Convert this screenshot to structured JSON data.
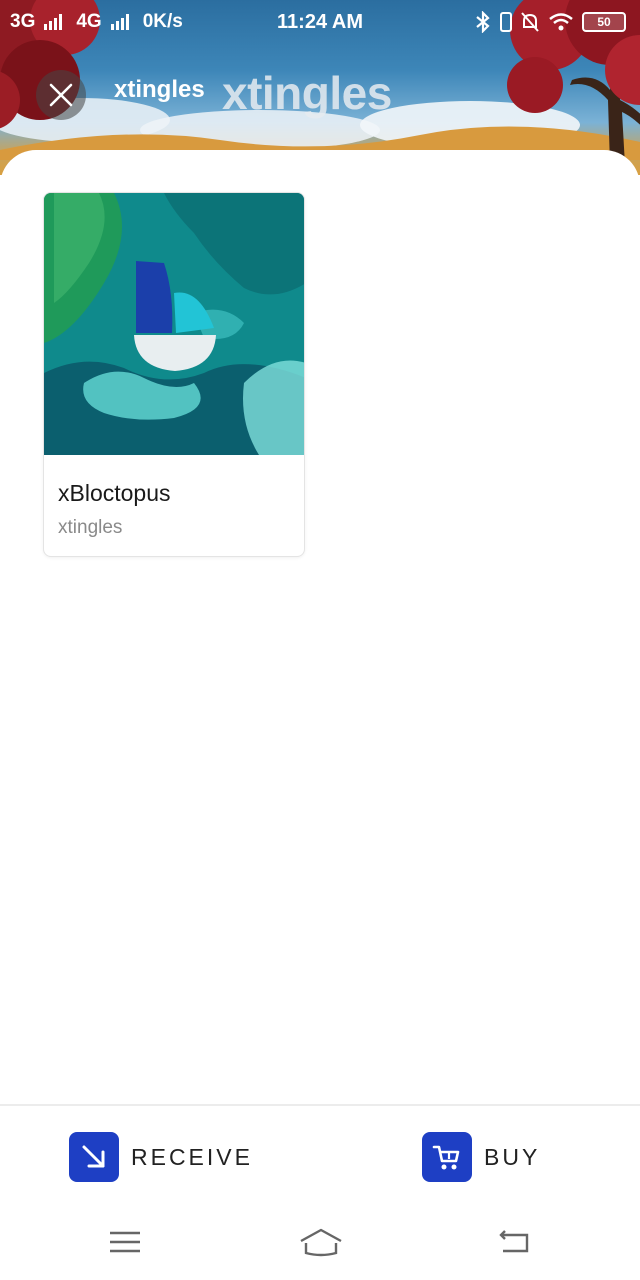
{
  "status_bar": {
    "network1": "3G",
    "network2": "4G",
    "speed": "0K/s",
    "time": "11:24 AM",
    "battery": "50"
  },
  "header": {
    "title": "xtingles",
    "banner_text": "xtingles"
  },
  "card": {
    "name": "xBloctopus",
    "creator": "xtingles"
  },
  "actions": {
    "receive_label": "RECEIVE",
    "buy_label": "BUY"
  },
  "colors": {
    "accent": "#1e3fc4",
    "text_primary": "#1a1a1a",
    "text_secondary": "#8a8a8a"
  },
  "icons": [
    "close-icon",
    "receive-arrow-icon",
    "cart-icon",
    "menu-icon",
    "home-icon",
    "back-icon",
    "bluetooth-icon",
    "wifi-icon",
    "mute-icon",
    "vibrate-icon"
  ]
}
